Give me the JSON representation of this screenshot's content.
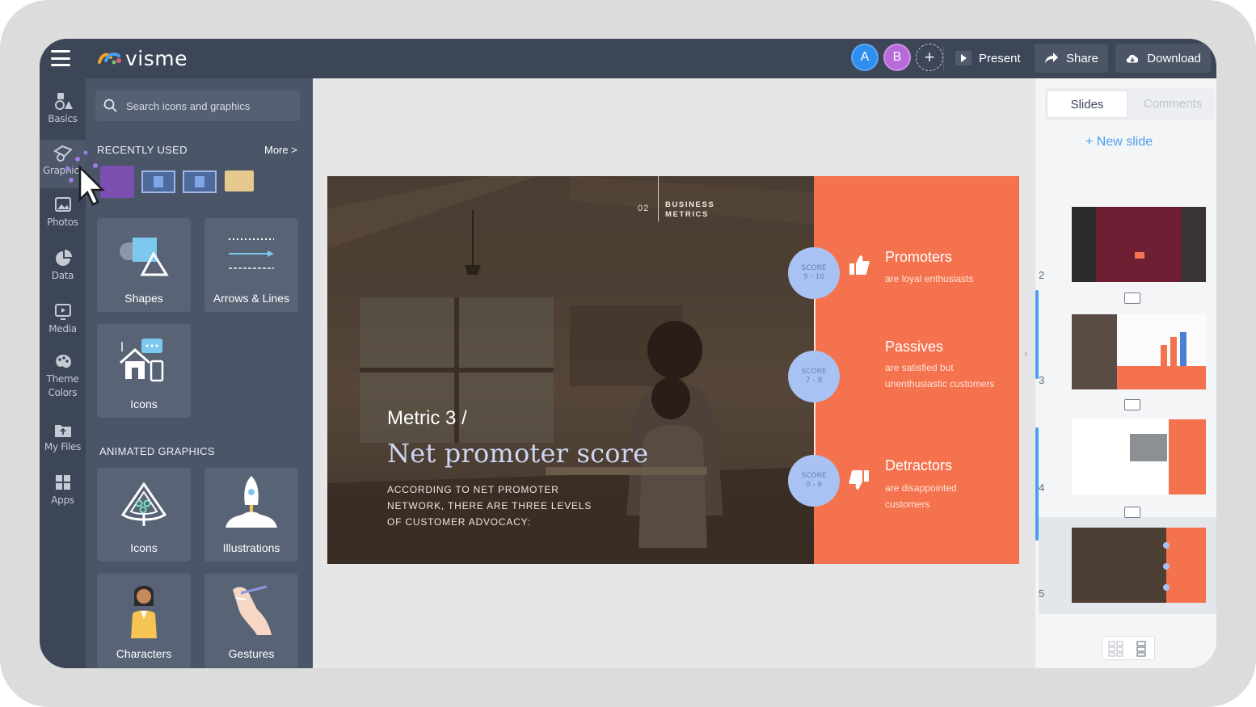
{
  "app": {
    "name": "visme"
  },
  "topbar": {
    "avatars": [
      "A",
      "B"
    ],
    "add_collaborator": "+",
    "present_label": "Present",
    "share_label": "Share",
    "download_label": "Download"
  },
  "rail": {
    "items": [
      {
        "label": "Basics",
        "icon": "basics-icon"
      },
      {
        "label": "Graphics",
        "icon": "graphics-icon"
      },
      {
        "label": "Photos",
        "icon": "photos-icon"
      },
      {
        "label": "Data",
        "icon": "data-icon"
      },
      {
        "label": "Media",
        "icon": "media-icon"
      },
      {
        "label": "Theme Colors",
        "icon": "palette-icon"
      },
      {
        "label": "My Files",
        "icon": "files-icon"
      },
      {
        "label": "Apps",
        "icon": "apps-icon"
      }
    ]
  },
  "panel": {
    "search_placeholder": "Search icons and graphics",
    "recently_used_title": "RECENTLY USED",
    "more_label": "More >",
    "tiles": [
      {
        "label": "Shapes"
      },
      {
        "label": "Arrows & Lines"
      },
      {
        "label": "Icons"
      }
    ],
    "animated_title": "ANIMATED GRAPHICS",
    "animated_tiles": [
      {
        "label": "Icons"
      },
      {
        "label": "Illustrations"
      },
      {
        "label": "Characters"
      },
      {
        "label": "Gestures"
      }
    ]
  },
  "slide": {
    "section_number": "02",
    "section_title": "BUSINESS METRICS",
    "metric_title": "Metric 3 /",
    "metric_subtitle": "Net promoter score",
    "body": "ACCORDING TO NET PROMOTER NETWORK, THERE ARE THREE LEVELS OF CUSTOMER ADVOCACY:",
    "levels": [
      {
        "score_label": "SCORE",
        "score_range": "9 - 10",
        "name": "Promoters",
        "description": "are loyal enthusiasts"
      },
      {
        "score_label": "SCORE",
        "score_range": "7 - 8",
        "name": "Passives",
        "description": "are satisfied but unenthusiastic customers"
      },
      {
        "score_label": "SCORE",
        "score_range": "0 - 6",
        "name": "Detractors",
        "description": "are disappointed customers"
      }
    ],
    "colors": {
      "accent": "#f4724d",
      "score_circle": "#a9c2f4"
    }
  },
  "slides_panel": {
    "tab_slides": "Slides",
    "tab_comments": "Comments",
    "new_slide_label": "+ New slide",
    "slide_numbers": [
      "2",
      "3",
      "4",
      "5"
    ],
    "selected": "5"
  }
}
